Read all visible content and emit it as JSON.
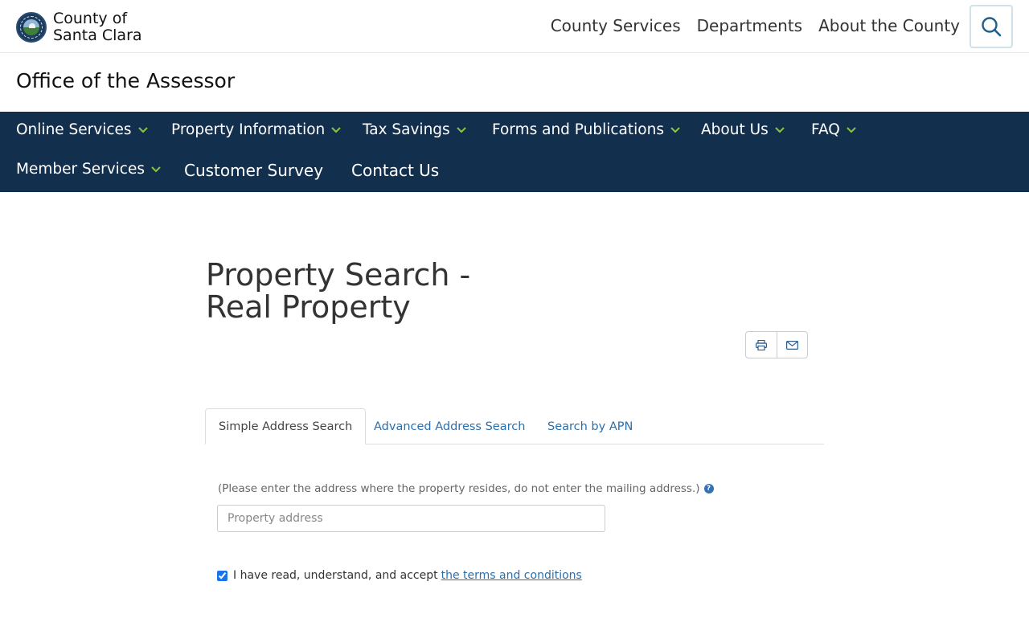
{
  "header": {
    "logo_line1": "County of",
    "logo_line2": "Santa Clara",
    "nav": [
      "County Services",
      "Departments",
      "About the County"
    ],
    "search_icon": "search-icon"
  },
  "office_title": "Office of the Assessor",
  "main_nav": {
    "items": [
      {
        "label": "Online Services",
        "dropdown": true
      },
      {
        "label": "Property Information",
        "dropdown": true
      },
      {
        "label": "Tax Savings",
        "dropdown": true
      },
      {
        "label": "Forms and Publications",
        "dropdown": true
      },
      {
        "label": "About Us",
        "dropdown": true
      },
      {
        "label": "FAQ",
        "dropdown": true
      },
      {
        "label": "Member Services",
        "dropdown": true
      },
      {
        "label": "Customer Survey",
        "dropdown": false
      },
      {
        "label": "Contact Us",
        "dropdown": false
      }
    ],
    "background": "#132f4e",
    "chevron_color": "#8cc63f"
  },
  "page": {
    "title_line1": "Property Search -",
    "title_line2": "Real Property",
    "share": [
      "print-icon",
      "email-icon"
    ]
  },
  "tabs": [
    {
      "label": "Simple Address Search",
      "active": true
    },
    {
      "label": "Advanced Address Search",
      "active": false
    },
    {
      "label": "Search by APN",
      "active": false
    }
  ],
  "form": {
    "hint": "(Please enter the address where the property resides, do not enter the mailing address.)",
    "address_placeholder": "Property address",
    "address_value": "",
    "terms_text": "I have read, understand, and accept",
    "terms_link": "the terms and conditions",
    "terms_checked": true
  }
}
